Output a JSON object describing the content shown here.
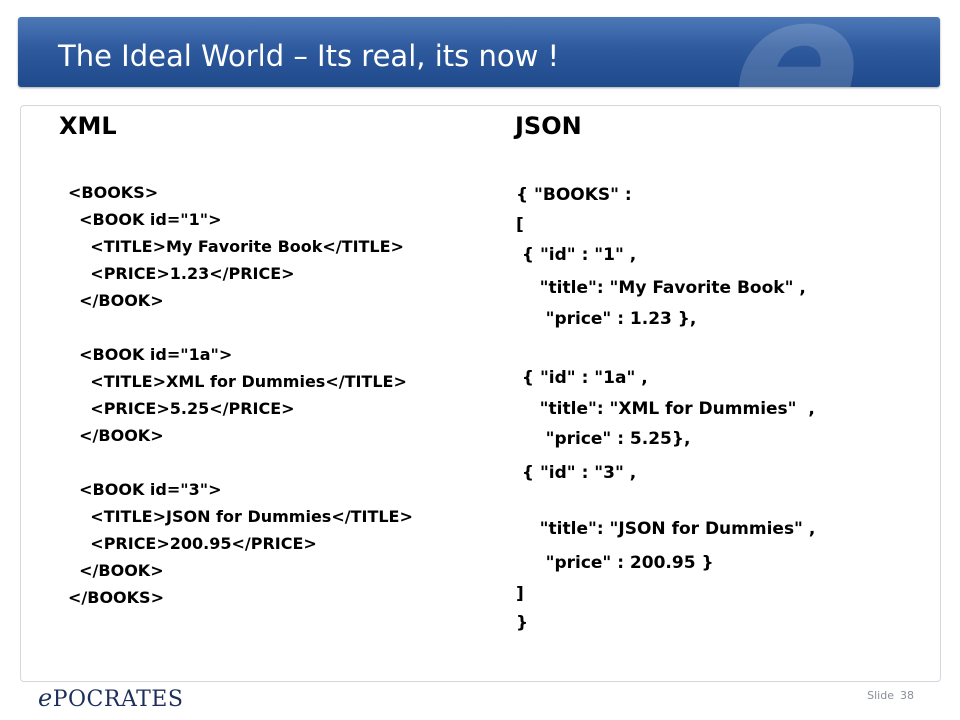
{
  "title": "The Ideal World – Its real, its now !",
  "xml": {
    "heading": "XML",
    "lines": [
      "<BOOKS>",
      "  <BOOK id=\"1\">",
      "    <TITLE>My Favorite Book</TITLE>",
      "    <PRICE>1.23</PRICE>",
      "  </BOOK>",
      "  <BOOK id=\"1a\">",
      "    <TITLE>XML for Dummies</TITLE>",
      "    <PRICE>5.25</PRICE>",
      "  </BOOK>",
      "  <BOOK id=\"3\">",
      "    <TITLE>JSON for Dummies</TITLE>",
      "    <PRICE>200.95</PRICE>",
      "  </BOOK>",
      "</BOOKS>"
    ]
  },
  "json": {
    "heading": "JSON",
    "lines": [
      "{ \"BOOKS\" :",
      "[",
      " { \"id\" : \"1\" ,",
      "    \"title\": \"My Favorite Book\" ,",
      "     \"price\" : 1.23 },",
      " { \"id\" : \"1a\" ,",
      "    \"title\": \"XML for Dummies\"  ,",
      "     \"price\" : 5.25},",
      " { \"id\" : \"3\" ,",
      "    \"title\": \"JSON for Dummies\" ,",
      "     \"price\" : 200.95 }",
      "]",
      "}"
    ]
  },
  "footer": {
    "logo_e": "e",
    "logo_rest": "POCRATES",
    "slide_label": "Slide",
    "slide_number": "38"
  }
}
